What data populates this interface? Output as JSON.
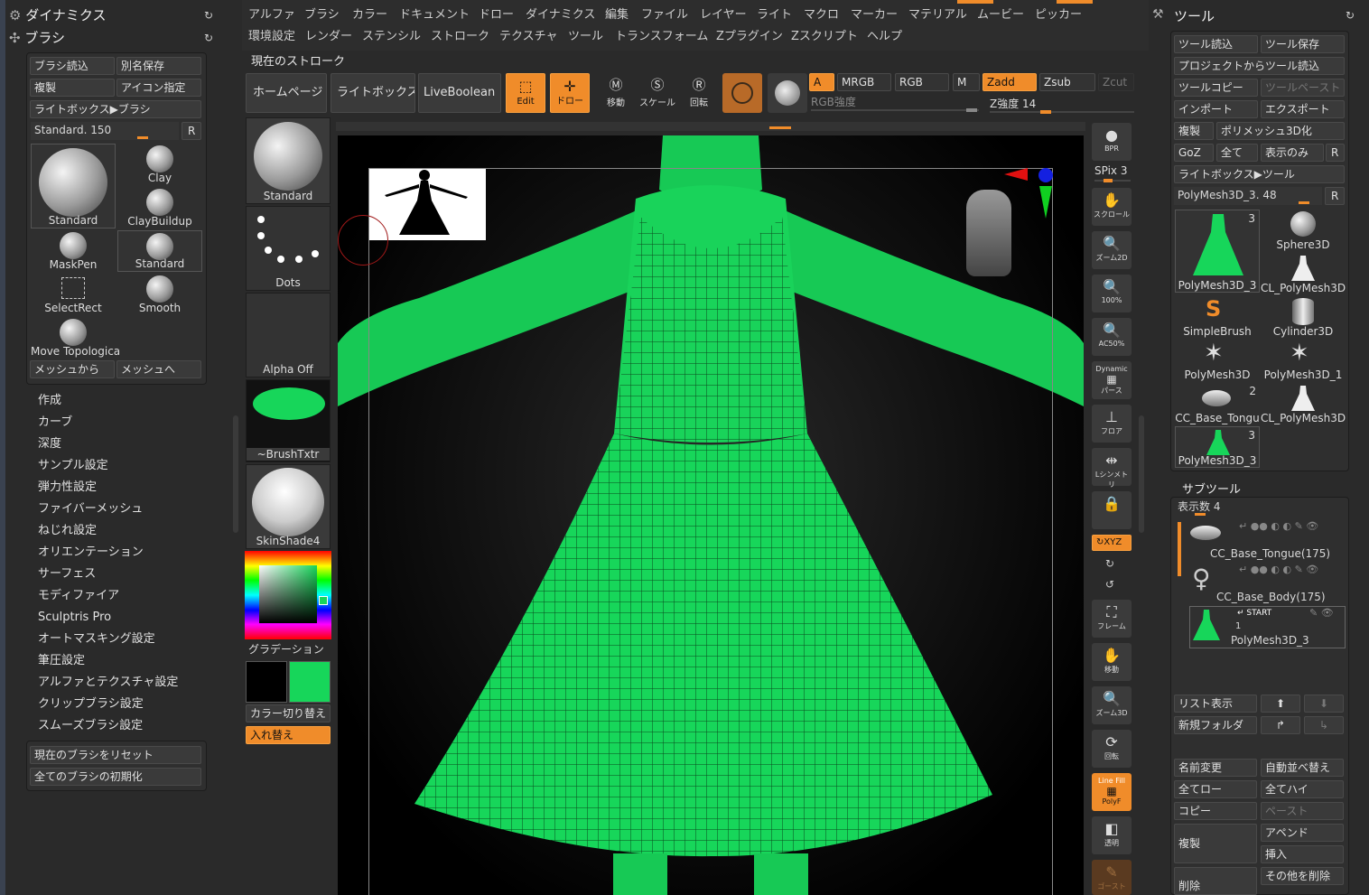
{
  "left_panel": {
    "title_dynamics": "ダイナミクス",
    "title_brush": "ブラシ",
    "load_brush": "ブラシ読込",
    "save_as": "別名保存",
    "duplicate": "複製",
    "set_icon": "アイコン指定",
    "lightbox_brush": "ライトボックス▶ブラシ",
    "current_brush_label": "Standard. 150",
    "r_label": "R",
    "brushes": [
      {
        "name": "Standard"
      },
      {
        "name": "Clay"
      },
      {
        "name": "ClayBuildup"
      },
      {
        "name": "MaskPen"
      },
      {
        "name": "Standard"
      },
      {
        "name": "SelectRect"
      },
      {
        "name": "Smooth"
      },
      {
        "name": "Move Topologica"
      }
    ],
    "from_mesh": "メッシュから",
    "to_mesh": "メッシュへ",
    "menu": [
      "作成",
      "カーブ",
      "深度",
      "サンプル設定",
      "弾力性設定",
      "ファイバーメッシュ",
      "ねじれ設定",
      "オリエンテーション",
      "サーフェス",
      "モディファイア",
      "Sculptris Pro",
      "オートマスキング設定",
      "筆圧設定",
      "アルファとテクスチャ設定",
      "クリップブラシ設定",
      "スムーズブラシ設定"
    ],
    "reset_brush": "現在のブラシをリセット",
    "init_all": "全てのブラシの初期化"
  },
  "top_menu": {
    "row1": [
      "アルファ",
      "ブラシ",
      "カラー",
      "ドキュメント",
      "ドロー",
      "ダイナミクス",
      "編集",
      "ファイル",
      "レイヤー",
      "ライト",
      "マクロ",
      "マーカー",
      "マテリアル",
      "ムービー",
      "ピッカー"
    ],
    "row2": [
      "環境設定",
      "レンダー",
      "ステンシル",
      "ストローク",
      "テクスチャ",
      "ツール",
      "トランスフォーム",
      "Zプラグイン",
      "Zスクリプト",
      "ヘルプ"
    ],
    "current_stroke": "現在のストローク"
  },
  "toolbar": {
    "home": "ホームページ",
    "lightbox": "ライトボックス",
    "liveboolean": "LiveBoolean",
    "edit": "Edit",
    "draw": "ドロー",
    "move": "移動",
    "scale": "スケール",
    "rotate": "回転",
    "a": "A",
    "mrgb": "MRGB",
    "rgb": "RGB",
    "m": "M",
    "zadd": "Zadd",
    "zsub": "Zsub",
    "zcut": "Zcut",
    "rgb_intensity": "RGB強度",
    "z_intensity": "Z強度 14"
  },
  "left_strip": {
    "stroke_name": "Standard",
    "dots": "Dots",
    "alpha": "Alpha Off",
    "texture": "~BrushTxtr",
    "material": "SkinShade4",
    "gradient": "グラデーション",
    "color_switch": "カラー切り替え",
    "swap": "入れ替え"
  },
  "right_nav": {
    "bpr": "BPR",
    "spix": "SPix 3",
    "scroll": "スクロール",
    "zoom2d": "ズーム2D",
    "pct100": "100%",
    "ac50": "AC50%",
    "dynamic": "Dynamic",
    "perspective": "パース",
    "floor": "フロア",
    "symmetry": "Lシンメトリ",
    "xyz": "XYZ",
    "frame": "フレーム",
    "move": "移動",
    "zoom3d": "ズーム3D",
    "rotate": "回転",
    "linefill": "Line Fill",
    "polyf": "PolyF",
    "transp": "透明",
    "ghost": "ゴースト"
  },
  "tool_panel": {
    "title": "ツール",
    "load_tool": "ツール読込",
    "save_tool": "ツール保存",
    "load_from_project": "プロジェクトからツール読込",
    "copy_tool": "ツールコピー",
    "paste_tool": "ツールペースト",
    "import": "インポート",
    "export": "エクスポート",
    "duplicate": "複製",
    "polymesh3d": "ポリメッシュ3D化",
    "goz": "GoZ",
    "all": "全て",
    "visible_only": "表示のみ",
    "r": "R",
    "lightbox_tool": "ライトボックス▶ツール",
    "current_tool": "PolyMesh3D_3. 48",
    "tools": [
      {
        "name": "PolyMesh3D_3",
        "count": "3"
      },
      {
        "name": "Sphere3D",
        "count": ""
      },
      {
        "name": "SimpleBrush",
        "count": ""
      },
      {
        "name": "CL_PolyMesh3D",
        "count": ""
      },
      {
        "name": "PolyMesh3D",
        "count": ""
      },
      {
        "name": "Cylinder3D",
        "count": ""
      },
      {
        "name": "CC_Base_Tongu",
        "count": "2"
      },
      {
        "name": "PolyMesh3D_1",
        "count": ""
      },
      {
        "name": "PolyMesh3D_3",
        "count": "3"
      },
      {
        "name": "CL_PolyMesh3D",
        "count": ""
      }
    ],
    "subtool_title": "サブツール",
    "display_count": "表示数 4",
    "subtools": [
      {
        "name": "CC_Base_Tongue(175)"
      },
      {
        "name": "CC_Base_Body(175)"
      },
      {
        "name": "PolyMesh3D_3",
        "extra": "1"
      }
    ],
    "start_label": "START",
    "list_view": "リスト表示",
    "new_folder": "新規フォルダ",
    "rename": "名前変更",
    "auto_sort": "自動並べ替え",
    "all_low": "全てロー",
    "all_high": "全てハイ",
    "copy": "コピー",
    "paste": "ペースト",
    "dup": "複製",
    "append": "アペンド",
    "insert": "挿入",
    "delete": "削除",
    "delete_other": "その他を削除"
  },
  "colors": {
    "accent": "#f08c2a",
    "mesh_green": "#17d65a",
    "panel_bg": "#2f2f2f"
  }
}
